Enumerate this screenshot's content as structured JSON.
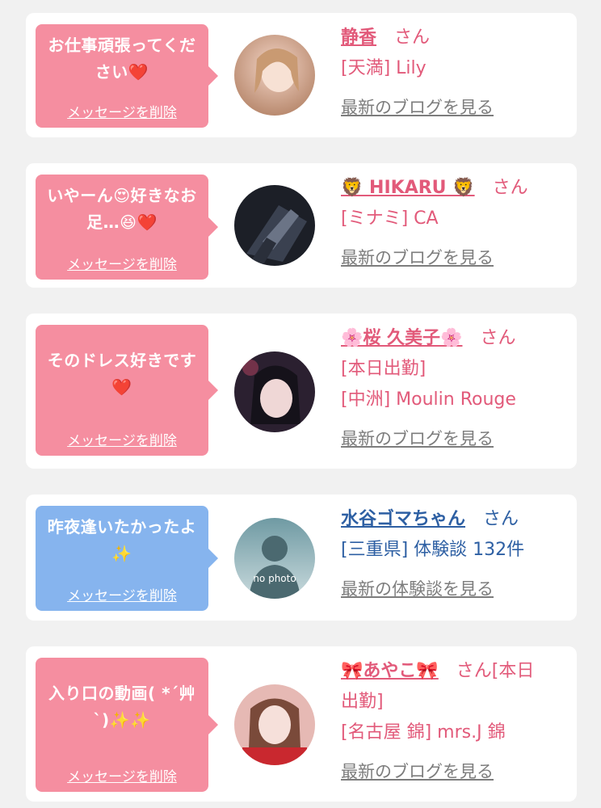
{
  "items": [
    {
      "message": "お仕事頑張ってください❤️",
      "delete_label": "メッセージを削除",
      "name": "静香",
      "honorific": "さん",
      "lines": [
        "[天満] Lily"
      ],
      "link": "最新のブログを見る",
      "bubble_color": "#f58ea0",
      "name_color": "#e25a7a"
    },
    {
      "message": "いやーん😍好きなお足…😆❤️",
      "delete_label": "メッセージを削除",
      "name": "🦁 HIKARU 🦁",
      "honorific": "さん",
      "lines": [
        "[ミナミ] CA"
      ],
      "link": "最新のブログを見る",
      "bubble_color": "#f58ea0",
      "name_color": "#e25a7a"
    },
    {
      "message": "そのドレス好きです❤️",
      "delete_label": "メッセージを削除",
      "name": "🌸桜 久美子🌸",
      "honorific": "さん",
      "lines": [
        "[本日出勤]",
        "[中洲] Moulin Rouge"
      ],
      "link": "最新のブログを見る",
      "bubble_color": "#f58ea0",
      "name_color": "#e25a7a"
    },
    {
      "message": "昨夜逢いたかったよ✨",
      "delete_label": "メッセージを削除",
      "name": "水谷ゴマちゃん",
      "honorific": "さん",
      "lines": [
        "[三重県] 体験談 132件"
      ],
      "link": "最新の体験談を見る",
      "avatar_text": "no photo",
      "bubble_color": "#86b4ee",
      "name_color": "#2d5fa3"
    },
    {
      "message": "入り口の動画( *´艸`)✨✨",
      "delete_label": "メッセージを削除",
      "name": "🎀あやこ🎀",
      "honorific": "さん[本日",
      "lines": [
        "出勤]",
        "[名古屋 錦] mrs.J 錦"
      ],
      "link": "最新のブログを見る",
      "bubble_color": "#f58ea0",
      "name_color": "#e25a7a"
    }
  ]
}
